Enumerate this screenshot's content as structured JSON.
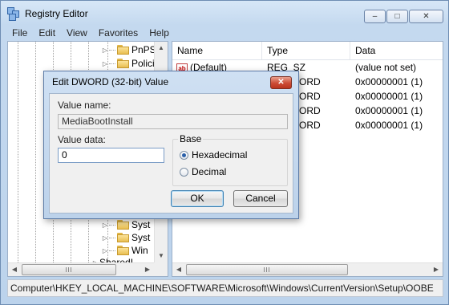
{
  "window": {
    "title": "Registry Editor",
    "minimize_glyph": "–",
    "maximize_glyph": "□",
    "close_glyph": "✕"
  },
  "menu": [
    "File",
    "Edit",
    "View",
    "Favorites",
    "Help"
  ],
  "tree": {
    "items": [
      {
        "label": "PnPSys",
        "expanded": false
      },
      {
        "label": "Policies",
        "expanded": false
      },
      {
        "label": "Syst",
        "expanded": false
      },
      {
        "label": "Syst",
        "expanded": false
      },
      {
        "label": "Win",
        "expanded": false
      },
      {
        "label": "SharedI",
        "expanded": false
      }
    ]
  },
  "list": {
    "columns": [
      "Name",
      "Type",
      "Data"
    ],
    "rows": [
      {
        "name": "(Default)",
        "type": "REG_SZ",
        "data": "(value not set)"
      },
      {
        "name": "",
        "type": "ORD",
        "data": "0x00000001 (1)"
      },
      {
        "name": "",
        "type": "ORD",
        "data": "0x00000001 (1)"
      },
      {
        "name": "",
        "type": "ORD",
        "data": "0x00000001 (1)"
      },
      {
        "name": "",
        "type": "ORD",
        "data": "0x00000001 (1)"
      }
    ]
  },
  "statusbar": {
    "path": "Computer\\HKEY_LOCAL_MACHINE\\SOFTWARE\\Microsoft\\Windows\\CurrentVersion\\Setup\\OOBE"
  },
  "dialog": {
    "title": "Edit DWORD (32-bit) Value",
    "close_glyph": "✕",
    "value_name_label": "Value name:",
    "value_name": "MediaBootInstall",
    "value_data_label": "Value data:",
    "value_data": "0",
    "base_label": "Base",
    "hex_label": "Hexadecimal",
    "dec_label": "Decimal",
    "selected_base": "Hexadecimal",
    "ok_label": "OK",
    "cancel_label": "Cancel"
  },
  "icons": {
    "tree_expand": "▷",
    "ab": "ab",
    "scroll_up": "▲",
    "scroll_down": "▼",
    "scroll_left": "◀",
    "scroll_right": "▶"
  }
}
